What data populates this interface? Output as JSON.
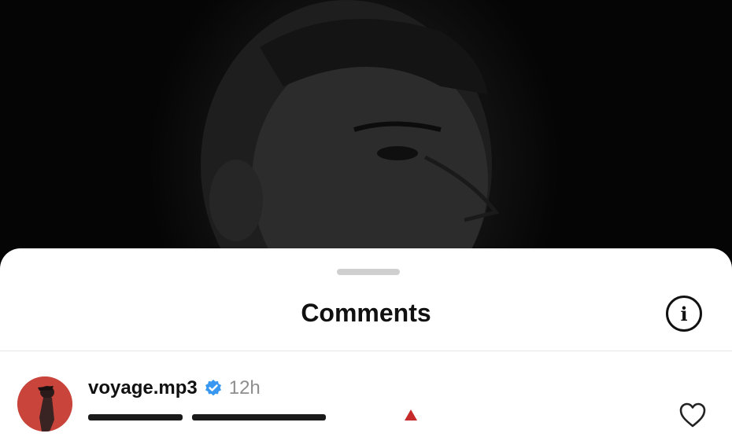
{
  "sheet": {
    "title": "Comments",
    "info_icon": "info-icon"
  },
  "comments": [
    {
      "username": "voyage.mp3",
      "verified": true,
      "time": "12h",
      "avatar_icon": "avatar",
      "like_icon": "heart-icon"
    }
  ],
  "colors": {
    "sheet_bg": "#ffffff",
    "verified": "#3897f0",
    "time": "#8e8e8e",
    "avatar_bg": "#c9443b"
  }
}
